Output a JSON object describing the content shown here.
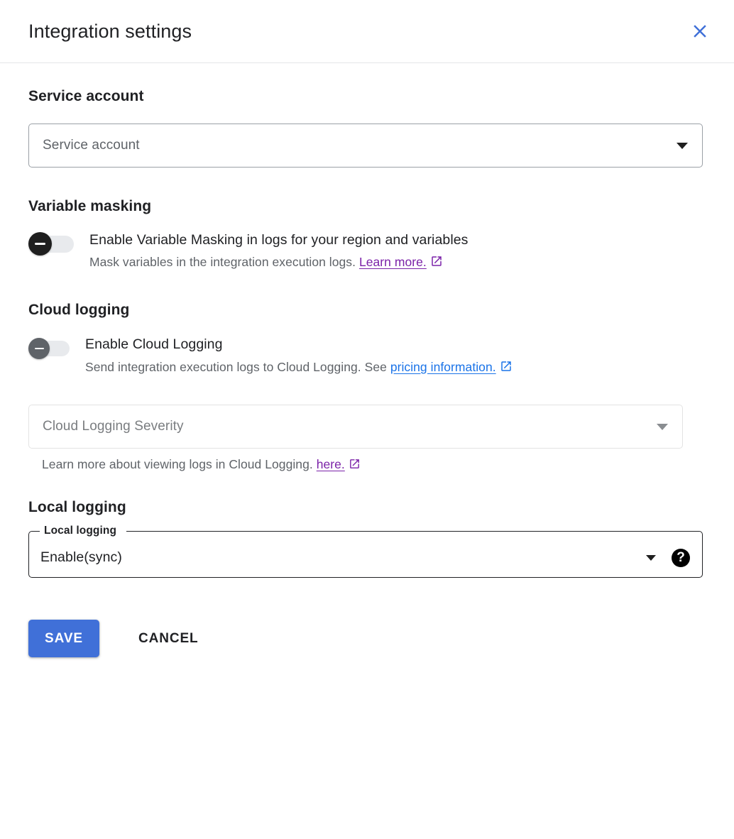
{
  "header": {
    "title": "Integration settings",
    "close_icon": "close-icon",
    "close_color": "#4070d8"
  },
  "service_account": {
    "heading": "Service account",
    "select_placeholder": "Service account",
    "caret_icon": "chevron-down-icon"
  },
  "variable_masking": {
    "heading": "Variable masking",
    "toggle_state": "off",
    "toggle_icon": "minus-icon",
    "label": "Enable Variable Masking in logs for your region and variables",
    "description_prefix": "Mask variables in the integration execution logs. ",
    "link_text": "Learn more.",
    "link_color": "#7b22a8",
    "link_icon": "open-in-new-icon"
  },
  "cloud_logging": {
    "heading": "Cloud logging",
    "toggle_state": "off",
    "toggle_icon": "minus-icon",
    "label": "Enable Cloud Logging",
    "description_prefix": "Send integration execution logs to Cloud Logging. See ",
    "link_text": "pricing information.",
    "link_color": "#1a73e8",
    "link_icon": "open-in-new-icon",
    "severity_placeholder": "Cloud Logging Severity",
    "severity_caret_icon": "chevron-down-icon",
    "hint_prefix": "Learn more about viewing logs in Cloud Logging. ",
    "hint_link_text": "here.",
    "hint_link_color": "#7b22a8",
    "hint_link_icon": "open-in-new-icon"
  },
  "local_logging": {
    "heading": "Local logging",
    "field_label": "Local logging",
    "field_value": "Enable(sync)",
    "caret_icon": "chevron-down-icon",
    "help_icon": "help-icon",
    "help_glyph": "?"
  },
  "actions": {
    "save_label": "SAVE",
    "cancel_label": "CANCEL",
    "save_color": "#4070d8"
  }
}
